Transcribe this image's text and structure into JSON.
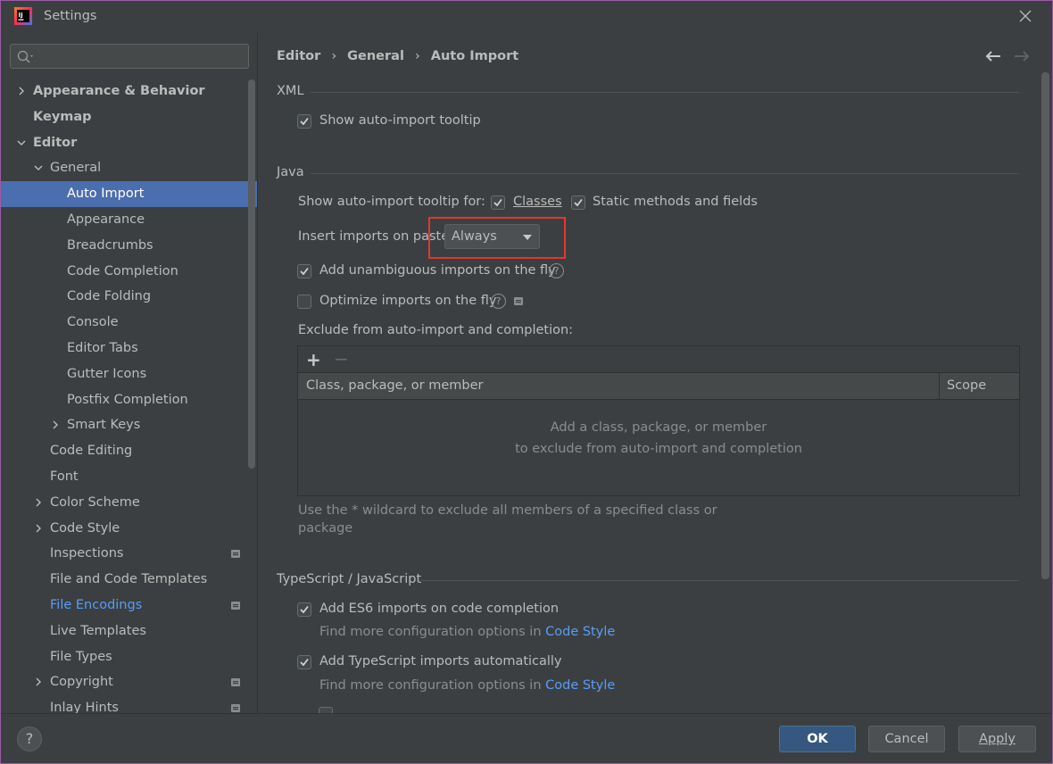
{
  "window": {
    "title": "Settings"
  },
  "sidebar": {
    "search": {
      "placeholder": ""
    },
    "items": [
      {
        "label": "Appearance & Behavior",
        "level": 0,
        "arrow": "right",
        "bold": true
      },
      {
        "label": "Keymap",
        "level": 0,
        "arrow": "none",
        "bold": true
      },
      {
        "label": "Editor",
        "level": 0,
        "arrow": "down",
        "bold": true
      },
      {
        "label": "General",
        "level": 1,
        "arrow": "down"
      },
      {
        "label": "Auto Import",
        "level": 2,
        "arrow": "none",
        "selected": true
      },
      {
        "label": "Appearance",
        "level": 2,
        "arrow": "none"
      },
      {
        "label": "Breadcrumbs",
        "level": 2,
        "arrow": "none"
      },
      {
        "label": "Code Completion",
        "level": 2,
        "arrow": "none"
      },
      {
        "label": "Code Folding",
        "level": 2,
        "arrow": "none"
      },
      {
        "label": "Console",
        "level": 2,
        "arrow": "none"
      },
      {
        "label": "Editor Tabs",
        "level": 2,
        "arrow": "none"
      },
      {
        "label": "Gutter Icons",
        "level": 2,
        "arrow": "none"
      },
      {
        "label": "Postfix Completion",
        "level": 2,
        "arrow": "none"
      },
      {
        "label": "Smart Keys",
        "level": 2,
        "arrow": "right"
      },
      {
        "label": "Code Editing",
        "level": 1,
        "arrow": "none"
      },
      {
        "label": "Font",
        "level": 1,
        "arrow": "none"
      },
      {
        "label": "Color Scheme",
        "level": 1,
        "arrow": "right"
      },
      {
        "label": "Code Style",
        "level": 1,
        "arrow": "right"
      },
      {
        "label": "Inspections",
        "level": 1,
        "arrow": "none",
        "mark": true
      },
      {
        "label": "File and Code Templates",
        "level": 1,
        "arrow": "none"
      },
      {
        "label": "File Encodings",
        "level": 1,
        "arrow": "none",
        "mark": true,
        "link": true
      },
      {
        "label": "Live Templates",
        "level": 1,
        "arrow": "none"
      },
      {
        "label": "File Types",
        "level": 1,
        "arrow": "none"
      },
      {
        "label": "Copyright",
        "level": 1,
        "arrow": "right",
        "mark": true
      },
      {
        "label": "Inlay Hints",
        "level": 1,
        "arrow": "none",
        "mark": true
      }
    ]
  },
  "breadcrumb": {
    "part1": "Editor",
    "part2": "General",
    "part3": "Auto Import",
    "sep": "›"
  },
  "xml": {
    "title": "XML",
    "show_tooltip": {
      "label": "Show auto-import tooltip",
      "checked": true
    }
  },
  "java": {
    "title": "Java",
    "tooltip_for_label": "Show auto-import tooltip for:",
    "classes": {
      "label": "Classes",
      "checked": true
    },
    "static_methods": {
      "label": "Static methods and fields",
      "checked": true
    },
    "insert_on_paste_label": "Insert imports on paste:",
    "insert_on_paste_value": "Always",
    "add_unambiguous": {
      "label": "Add unambiguous imports on the fly",
      "checked": true
    },
    "optimize_on_fly": {
      "label": "Optimize imports on the fly",
      "checked": false
    },
    "exclude_label": "Exclude from auto-import and completion:",
    "table": {
      "plus": "+",
      "minus": "−",
      "col1": "Class, package, or member",
      "col2": "Scope",
      "empty_line1": "Add a class, package, or member",
      "empty_line2": "to exclude from auto-import and completion"
    },
    "wildcard_hint_1": "Use the * wildcard to exclude all members of a specified class or",
    "wildcard_hint_2": "package"
  },
  "ts": {
    "title": "TypeScript / JavaScript",
    "es6": {
      "label": "Add ES6 imports on code completion",
      "checked": true
    },
    "es6_hint": "Find more configuration options in",
    "es6_link": "Code Style",
    "ts_auto": {
      "label": "Add TypeScript imports automatically",
      "checked": true
    },
    "ts_hint": "Find more configuration options in",
    "ts_link": "Code Style"
  },
  "footer": {
    "help": "?",
    "ok": "OK",
    "cancel": "Cancel",
    "apply": "Apply"
  },
  "colors": {
    "background": "#3c3f41",
    "selection": "#4b6eaf",
    "link": "#589df6",
    "highlight_box": "#e1372e",
    "ok_button": "#365880"
  }
}
